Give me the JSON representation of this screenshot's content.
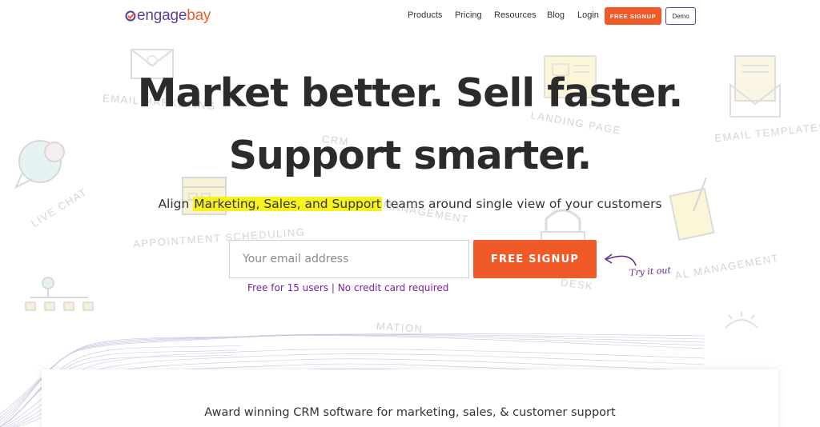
{
  "brand": {
    "part1": "engage",
    "part2": "bay"
  },
  "nav": {
    "products": "Products",
    "pricing": "Pricing",
    "resources": "Resources",
    "blog": "Blog",
    "login": "Login",
    "signup": "FREE SIGNUP",
    "demo": "Demo"
  },
  "hero": {
    "headline_line1": "Market better. Sell faster.",
    "headline_line2": "Support smarter.",
    "subline_before": "Align ",
    "subline_highlight": "Marketing, Sales, and Support",
    "subline_after": " teams around single view of your customers",
    "email_placeholder": "Your email address",
    "cta_label": "FREE SIGNUP",
    "tryit": "Try it out",
    "free_note": "Free for 15 users | No credit card required"
  },
  "background_labels": {
    "email_marketing": "EMAIL MARKETING",
    "landing_page": "LANDING PAGE",
    "email_templates": "EMAIL TEMPLATES",
    "crm": "CRM",
    "live_chat": "LIVE CHAT",
    "appointment": "APPOINTMENT SCHEDULING",
    "management_mid": "MANAGEMENT",
    "management_right": "AL MANAGEMENT",
    "desk": "DESK",
    "mation": "MATION"
  },
  "award": {
    "text": "Award winning CRM software for marketing, sales, & customer support"
  },
  "colors": {
    "accent": "#f05a28",
    "brand_purple": "#5b3f9e",
    "highlight": "#f7f11d",
    "note_purple": "#7b1fa2"
  }
}
